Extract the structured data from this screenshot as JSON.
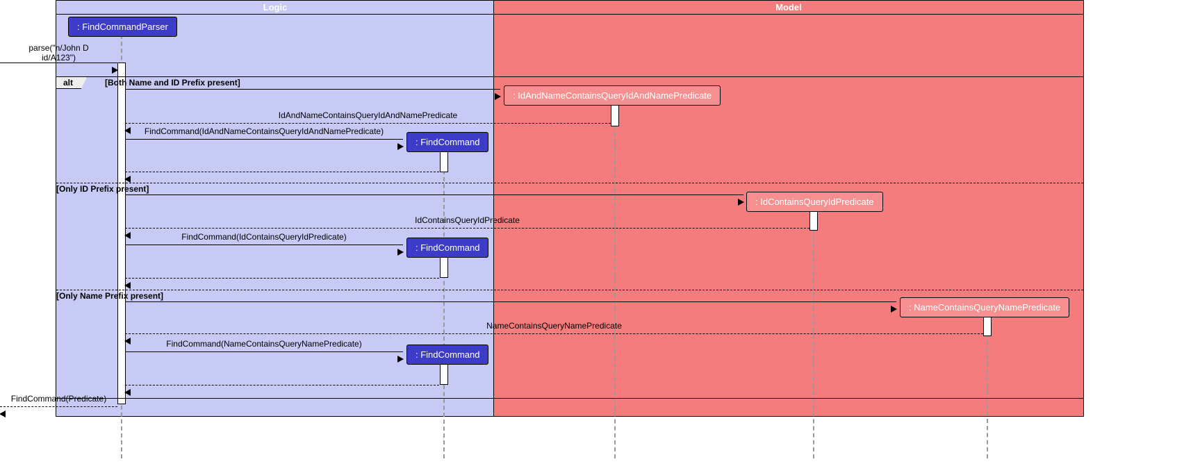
{
  "regions": {
    "logic": "Logic",
    "model": "Model"
  },
  "participants": {
    "parser": ": FindCommandParser",
    "idNamePred": ": IdAndNameContainsQueryIdAndNamePredicate",
    "idPred": ": IdContainsQueryIdPredicate",
    "namePred": ": NameContainsQueryNamePredicate",
    "findCmd": ": FindCommand"
  },
  "alt": {
    "label": "alt",
    "guard1": "[Both Name and ID Prefix present]",
    "guard2": "[Only ID Prefix present]",
    "guard3": "[Only Name Prefix present]"
  },
  "messages": {
    "parseIn": "parse(\"n/John D\nid/A123\")",
    "ret1": "IdAndNameContainsQueryIdAndNamePredicate",
    "call1": "FindCommand(IdAndNameContainsQueryIdAndNamePredicate)",
    "ret2": "IdContainsQueryIdPredicate",
    "call2": "FindCommand(IdContainsQueryIdPredicate)",
    "ret3": "NameContainsQueryNamePredicate",
    "call3": "FindCommand(NameContainsQueryNamePredicate)",
    "final": "FindCommand(Predicate)"
  }
}
